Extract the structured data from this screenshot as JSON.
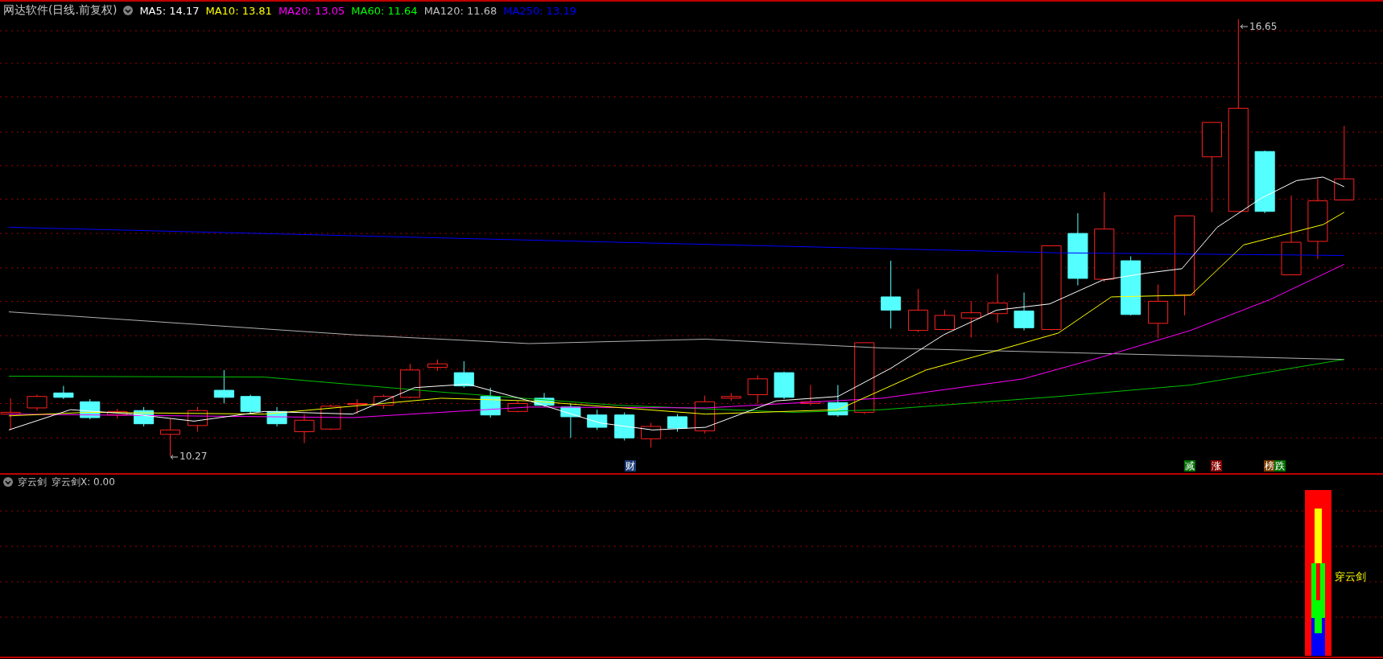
{
  "header": {
    "title": "网达软件(日线.前复权)",
    "indicators": [
      {
        "text": "MA5: 14.17",
        "color": "#ffffff"
      },
      {
        "text": "MA10: 13.81",
        "color": "#ffff00"
      },
      {
        "text": "MA20: 13.05",
        "color": "#ff00ff"
      },
      {
        "text": "MA60: 11.64",
        "color": "#00ff00"
      },
      {
        "text": "MA120: 11.68",
        "color": "#c0c0c0"
      },
      {
        "text": "MA250: 13.19",
        "color": "#0000ff"
      }
    ]
  },
  "price_chart": {
    "high_label": "16.65",
    "low_label": "10.27",
    "tags": [
      {
        "text": "财",
        "color": "#1c3c78"
      },
      {
        "text": "减",
        "color": "#007000"
      },
      {
        "text": "涨",
        "color": "#8a0000"
      },
      {
        "text": "榜",
        "color": "#7a3e00"
      },
      {
        "text": "跌",
        "color": "#007000"
      }
    ]
  },
  "indicator_panel": {
    "name": "穿云剑",
    "value": "穿云剑X: 0.00",
    "signal_label": "穿云剑"
  }
}
